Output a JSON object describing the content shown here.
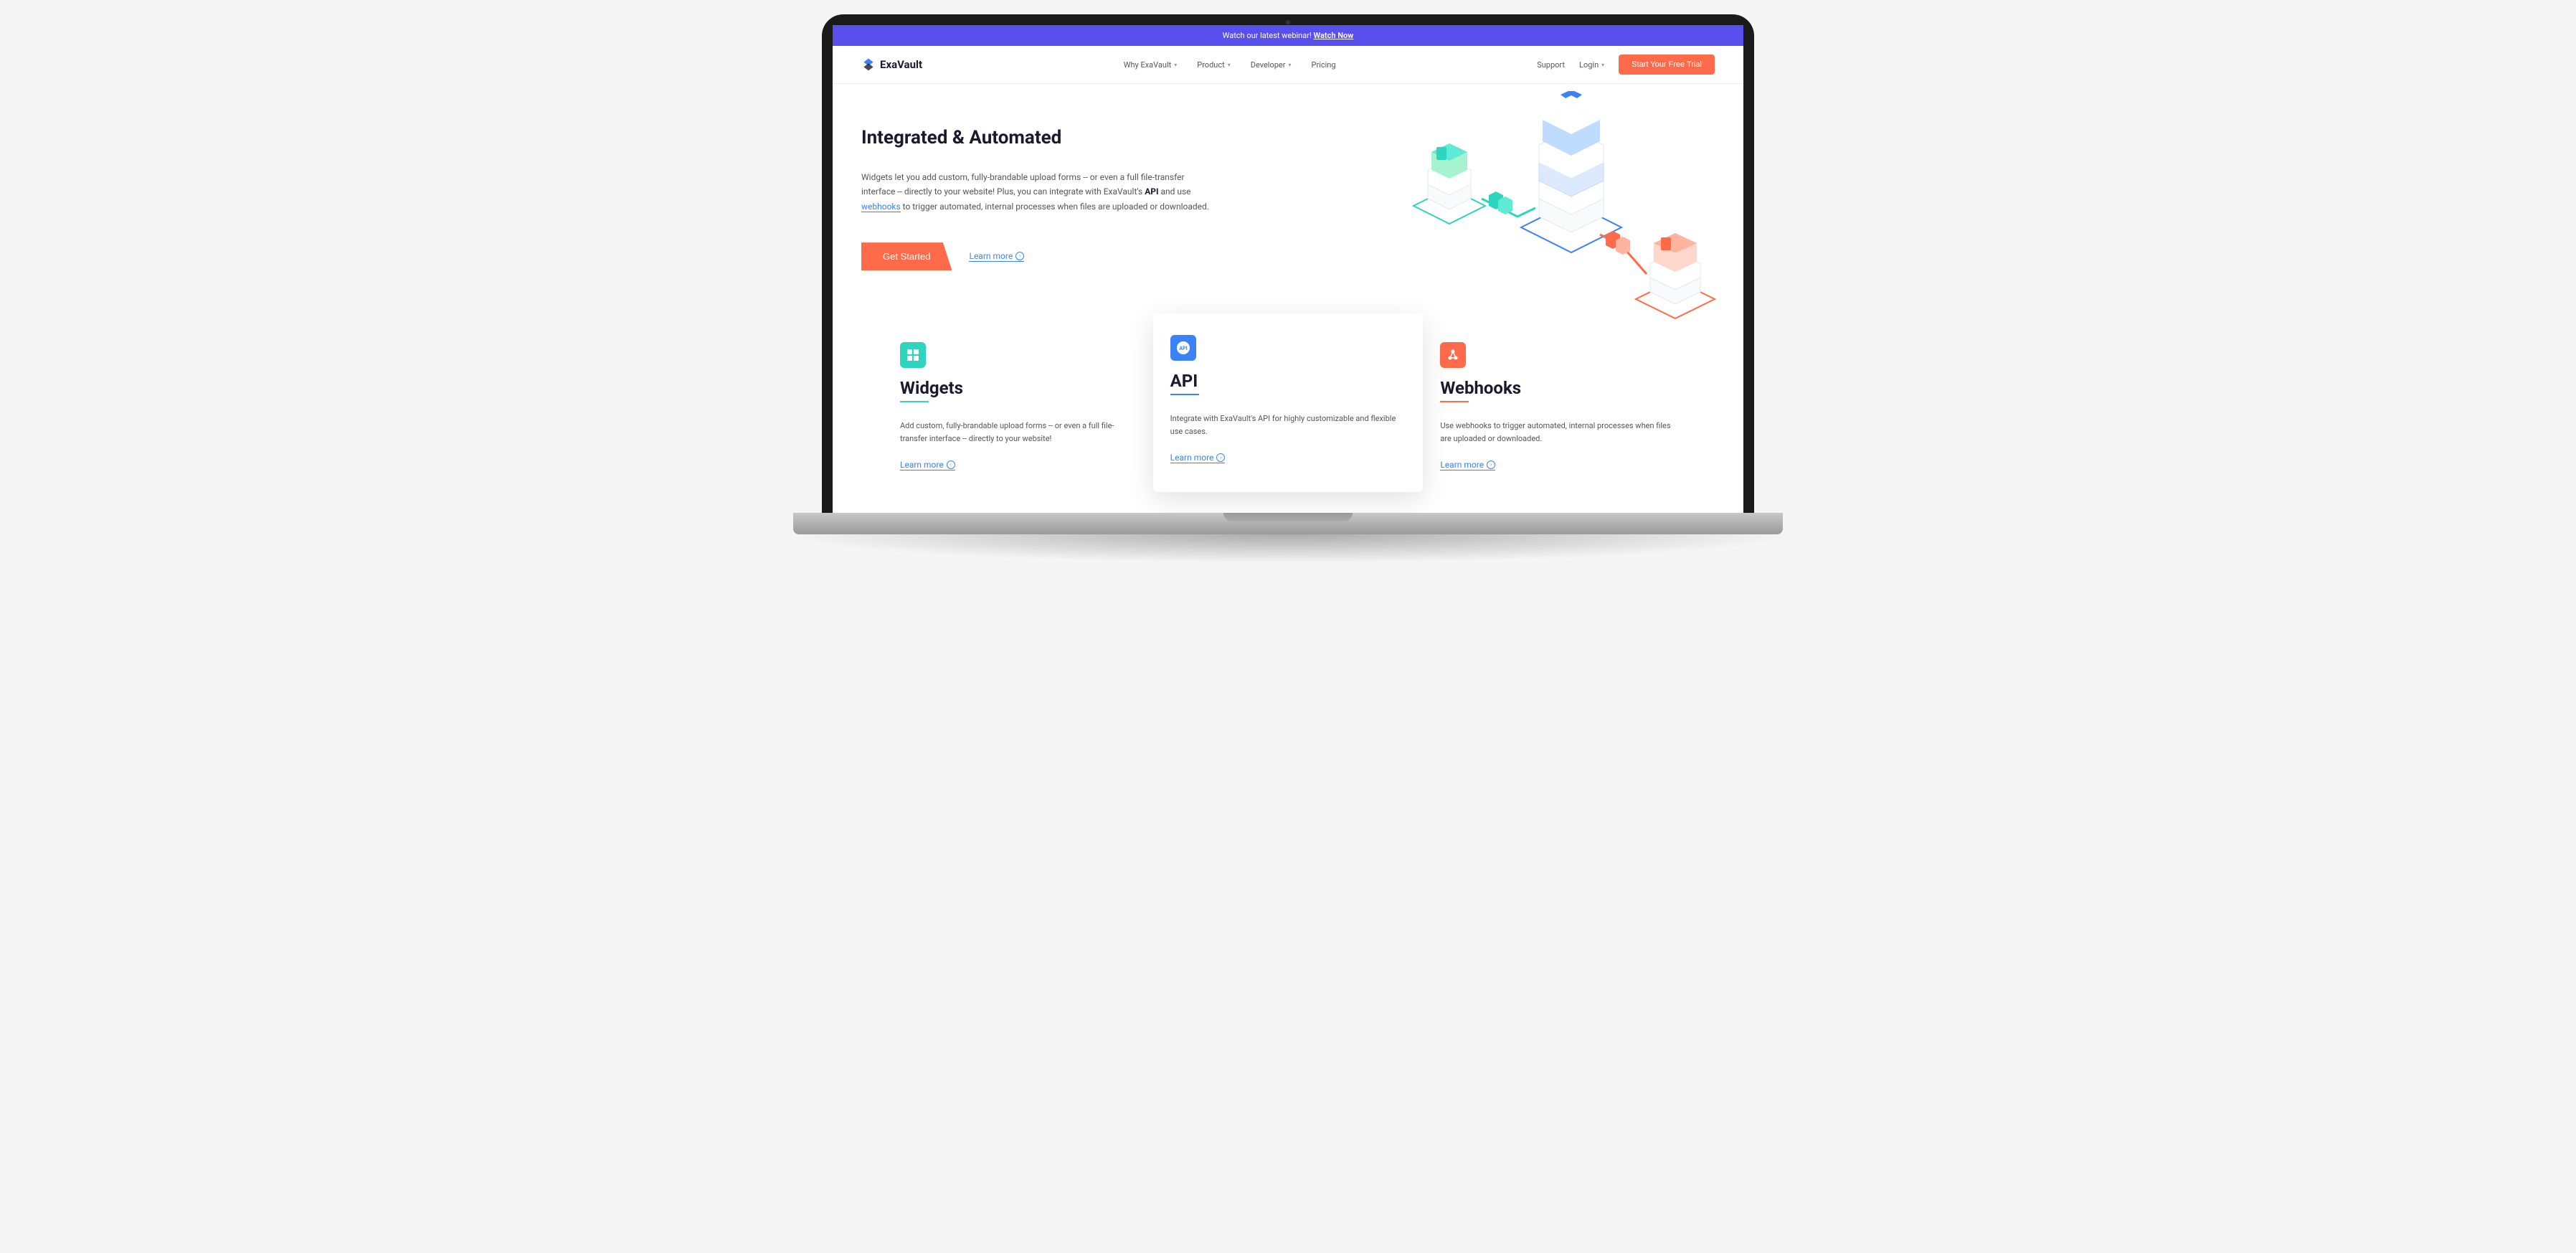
{
  "announce": {
    "text": "Watch our latest webinar! ",
    "link_text": "Watch Now"
  },
  "brand": "ExaVault",
  "nav": {
    "items": [
      {
        "label": "Why ExaVault"
      },
      {
        "label": "Product"
      },
      {
        "label": "Developer"
      },
      {
        "label": "Pricing"
      }
    ],
    "support": "Support",
    "login": "Login",
    "cta": "Start Your Free Trial"
  },
  "hero": {
    "title": "Integrated & Automated",
    "p1": "Widgets let you add custom, fully-brandable upload forms -- or even a full file-transfer interface -- directly to your website! Plus, you can integrate with ExaVault's ",
    "api": "API",
    "p2": " and use ",
    "webhooks": "webhooks",
    "p3": " to trigger automated, internal processes when files are uploaded or downloaded.",
    "get_started": "Get Started",
    "learn_more": "Learn more"
  },
  "cards": [
    {
      "title": "Widgets",
      "desc": "Add custom, fully-brandable upload forms -- or even a full file-transfer interface -- directly to your website!",
      "learn": "Learn more",
      "color": "teal"
    },
    {
      "title": "API",
      "desc": "Integrate with ExaVault's API for highly customizable and flexible use cases.",
      "learn": "Learn more",
      "color": "blue"
    },
    {
      "title": "Webhooks",
      "desc": "Use webhooks to trigger automated, internal processes when files are uploaded or downloaded.",
      "learn": "Learn more",
      "color": "orange"
    }
  ]
}
